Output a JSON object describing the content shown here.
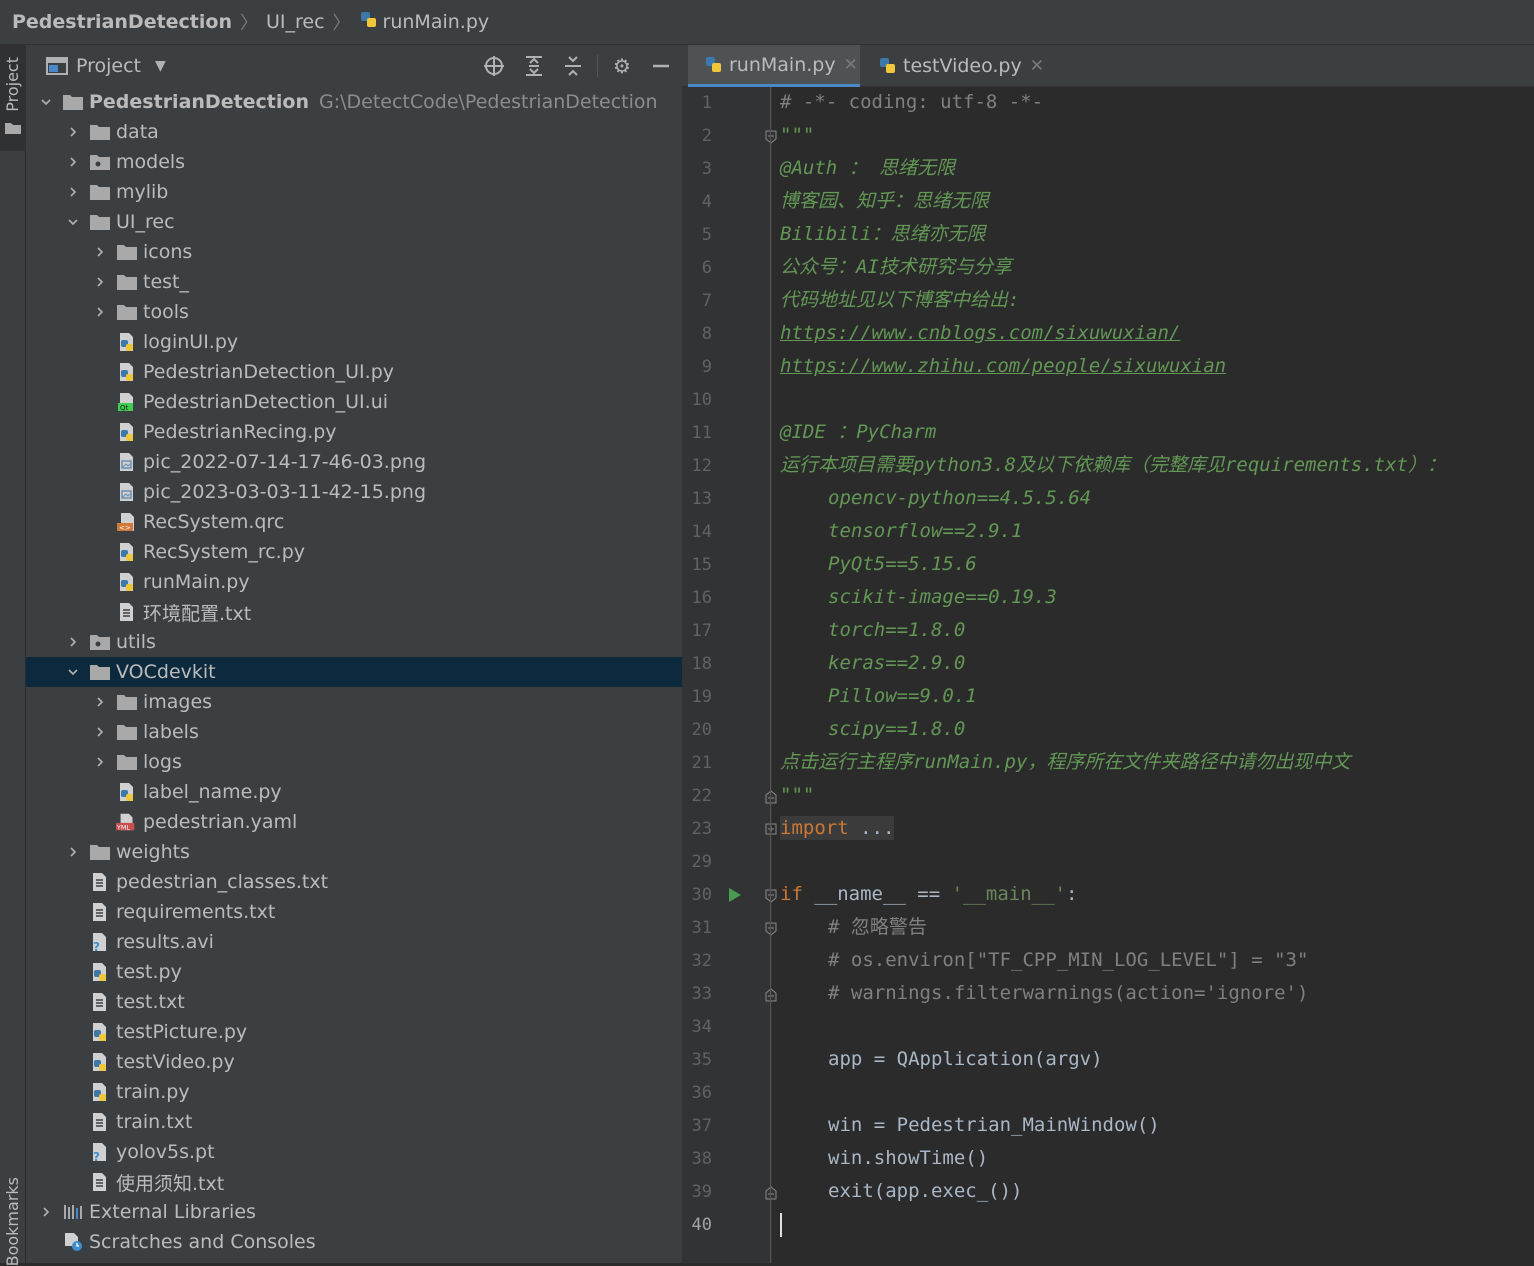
{
  "breadcrumb": {
    "root": "PedestrianDetection",
    "folder": "UI_rec",
    "file": "runMain.py"
  },
  "side_tabs": {
    "project": "Project",
    "bookmarks": "Bookmarks"
  },
  "project_panel": {
    "title": "Project"
  },
  "tree": [
    {
      "depth": 0,
      "expanded": true,
      "icon": "folder",
      "label": "PedestrianDetection",
      "path": "G:\\DetectCode\\PedestrianDetection",
      "bold": true
    },
    {
      "depth": 1,
      "expanded": false,
      "icon": "folder",
      "label": "data"
    },
    {
      "depth": 1,
      "expanded": false,
      "icon": "package-folder",
      "label": "models"
    },
    {
      "depth": 1,
      "expanded": false,
      "icon": "folder",
      "label": "mylib"
    },
    {
      "depth": 1,
      "expanded": true,
      "icon": "folder",
      "label": "UI_rec"
    },
    {
      "depth": 2,
      "expanded": false,
      "icon": "folder",
      "label": "icons"
    },
    {
      "depth": 2,
      "expanded": false,
      "icon": "folder",
      "label": "test_"
    },
    {
      "depth": 2,
      "expanded": false,
      "icon": "folder",
      "label": "tools"
    },
    {
      "depth": 2,
      "icon": "python",
      "label": "loginUI.py"
    },
    {
      "depth": 2,
      "icon": "python",
      "label": "PedestrianDetection_UI.py"
    },
    {
      "depth": 2,
      "icon": "qt",
      "label": "PedestrianDetection_UI.ui"
    },
    {
      "depth": 2,
      "icon": "python",
      "label": "PedestrianRecing.py"
    },
    {
      "depth": 2,
      "icon": "image",
      "label": "pic_2022-07-14-17-46-03.png"
    },
    {
      "depth": 2,
      "icon": "image",
      "label": "pic_2023-03-03-11-42-15.png"
    },
    {
      "depth": 2,
      "icon": "qrc",
      "label": "RecSystem.qrc"
    },
    {
      "depth": 2,
      "icon": "python",
      "label": "RecSystem_rc.py"
    },
    {
      "depth": 2,
      "icon": "python",
      "label": "runMain.py"
    },
    {
      "depth": 2,
      "icon": "text",
      "label": "环境配置.txt"
    },
    {
      "depth": 1,
      "expanded": false,
      "icon": "package-folder",
      "label": "utils"
    },
    {
      "depth": 1,
      "expanded": true,
      "icon": "folder",
      "label": "VOCdevkit",
      "selected": true
    },
    {
      "depth": 2,
      "expanded": false,
      "icon": "folder",
      "label": "images"
    },
    {
      "depth": 2,
      "expanded": false,
      "icon": "folder",
      "label": "labels"
    },
    {
      "depth": 2,
      "expanded": false,
      "icon": "folder",
      "label": "logs"
    },
    {
      "depth": 2,
      "icon": "python",
      "label": "label_name.py"
    },
    {
      "depth": 2,
      "icon": "yaml",
      "label": "pedestrian.yaml"
    },
    {
      "depth": 1,
      "expanded": false,
      "icon": "folder",
      "label": "weights"
    },
    {
      "depth": 1,
      "icon": "text",
      "label": "pedestrian_classes.txt"
    },
    {
      "depth": 1,
      "icon": "text",
      "label": "requirements.txt"
    },
    {
      "depth": 1,
      "icon": "unknown",
      "label": "results.avi"
    },
    {
      "depth": 1,
      "icon": "python",
      "label": "test.py"
    },
    {
      "depth": 1,
      "icon": "text",
      "label": "test.txt"
    },
    {
      "depth": 1,
      "icon": "python",
      "label": "testPicture.py"
    },
    {
      "depth": 1,
      "icon": "python",
      "label": "testVideo.py"
    },
    {
      "depth": 1,
      "icon": "python",
      "label": "train.py"
    },
    {
      "depth": 1,
      "icon": "text",
      "label": "train.txt"
    },
    {
      "depth": 1,
      "icon": "unknown",
      "label": "yolov5s.pt"
    },
    {
      "depth": 1,
      "icon": "text",
      "label": "使用须知.txt"
    },
    {
      "depth": 0,
      "expanded": false,
      "icon": "libraries",
      "label": "External Libraries"
    },
    {
      "depth": 0,
      "icon": "scratches",
      "label": "Scratches and Consoles"
    }
  ],
  "tabs": [
    {
      "label": "runMain.py",
      "active": true
    },
    {
      "label": "testVideo.py",
      "active": false
    }
  ],
  "code": [
    {
      "n": "1",
      "indent": 0,
      "tokens": [
        [
          "cm",
          "# -*- coding: utf-8 -*-"
        ]
      ]
    },
    {
      "n": "2",
      "indent": 0,
      "tokens": [
        [
          "doc",
          "\"\"\""
        ]
      ],
      "fold": "open"
    },
    {
      "n": "3",
      "indent": 0,
      "tokens": [
        [
          "doc",
          "@Auth ： 思绪无限"
        ]
      ]
    },
    {
      "n": "4",
      "indent": 0,
      "tokens": [
        [
          "doc",
          "博客园、知乎：思绪无限"
        ]
      ]
    },
    {
      "n": "5",
      "indent": 0,
      "tokens": [
        [
          "doc",
          "Bilibili：思绪亦无限"
        ]
      ]
    },
    {
      "n": "6",
      "indent": 0,
      "tokens": [
        [
          "doc",
          "公众号：AI技术研究与分享"
        ]
      ]
    },
    {
      "n": "7",
      "indent": 0,
      "tokens": [
        [
          "doc",
          "代码地址见以下博客中给出:"
        ]
      ]
    },
    {
      "n": "8",
      "indent": 0,
      "tokens": [
        [
          "link",
          "https://www.cnblogs.com/sixuwuxian/"
        ]
      ]
    },
    {
      "n": "9",
      "indent": 0,
      "tokens": [
        [
          "link",
          "https://www.zhihu.com/people/sixuwuxian"
        ]
      ]
    },
    {
      "n": "10",
      "indent": 0,
      "tokens": []
    },
    {
      "n": "11",
      "indent": 0,
      "tokens": [
        [
          "doc",
          "@IDE ：PyCharm"
        ]
      ]
    },
    {
      "n": "12",
      "indent": 0,
      "tokens": [
        [
          "doc",
          "运行本项目需要python3.8及以下依赖库（完整库见requirements.txt）："
        ]
      ]
    },
    {
      "n": "13",
      "indent": 1,
      "tokens": [
        [
          "doc",
          "opencv-python==4.5.5.64"
        ]
      ]
    },
    {
      "n": "14",
      "indent": 1,
      "tokens": [
        [
          "doc",
          "tensorflow==2.9.1"
        ]
      ]
    },
    {
      "n": "15",
      "indent": 1,
      "tokens": [
        [
          "doc",
          "PyQt5==5.15.6"
        ]
      ]
    },
    {
      "n": "16",
      "indent": 1,
      "tokens": [
        [
          "doc",
          "scikit-image==0.19.3"
        ]
      ]
    },
    {
      "n": "17",
      "indent": 1,
      "tokens": [
        [
          "doc",
          "torch==1.8.0"
        ]
      ]
    },
    {
      "n": "18",
      "indent": 1,
      "tokens": [
        [
          "doc",
          "keras==2.9.0"
        ]
      ]
    },
    {
      "n": "19",
      "indent": 1,
      "tokens": [
        [
          "doc",
          "Pillow==9.0.1"
        ]
      ]
    },
    {
      "n": "20",
      "indent": 1,
      "tokens": [
        [
          "doc",
          "scipy==1.8.0"
        ]
      ]
    },
    {
      "n": "21",
      "indent": 0,
      "tokens": [
        [
          "doc",
          "点击运行主程序runMain.py，程序所在文件夹路径中请勿出现中文"
        ]
      ]
    },
    {
      "n": "22",
      "indent": 0,
      "tokens": [
        [
          "doc",
          "\"\"\""
        ]
      ],
      "fold": "close"
    },
    {
      "n": "23",
      "indent": 0,
      "tokens": [
        [
          "kw",
          "import"
        ],
        [
          "tx",
          " ..."
        ]
      ],
      "fold": "plus",
      "folded": true
    },
    {
      "n": "29",
      "indent": 0,
      "tokens": []
    },
    {
      "n": "30",
      "indent": 0,
      "tokens": [
        [
          "kw",
          "if"
        ],
        [
          "tx",
          " __name__ == "
        ],
        [
          "str",
          "'__main__'"
        ],
        [
          "tx",
          ":"
        ]
      ],
      "fold": "open",
      "run": true
    },
    {
      "n": "31",
      "indent": 1,
      "tokens": [
        [
          "cm",
          "# 忽略警告"
        ]
      ],
      "fold": "open"
    },
    {
      "n": "32",
      "indent": 1,
      "tokens": [
        [
          "cm",
          "# os.environ[\"TF_CPP_MIN_LOG_LEVEL\"] = \"3\""
        ]
      ]
    },
    {
      "n": "33",
      "indent": 1,
      "tokens": [
        [
          "cm",
          "# warnings.filterwarnings(action='ignore')"
        ]
      ],
      "fold": "close"
    },
    {
      "n": "34",
      "indent": 0,
      "tokens": []
    },
    {
      "n": "35",
      "indent": 1,
      "tokens": [
        [
          "tx",
          "app = QApplication(argv)"
        ]
      ]
    },
    {
      "n": "36",
      "indent": 0,
      "tokens": []
    },
    {
      "n": "37",
      "indent": 1,
      "tokens": [
        [
          "tx",
          "win = Pedestrian_MainWindow()"
        ]
      ]
    },
    {
      "n": "38",
      "indent": 1,
      "tokens": [
        [
          "tx",
          "win.showTime()"
        ]
      ]
    },
    {
      "n": "39",
      "indent": 1,
      "tokens": [
        [
          "tx",
          "exit(app.exec_())"
        ]
      ],
      "fold": "close"
    },
    {
      "n": "40",
      "indent": 0,
      "tokens": [],
      "current": true
    }
  ]
}
